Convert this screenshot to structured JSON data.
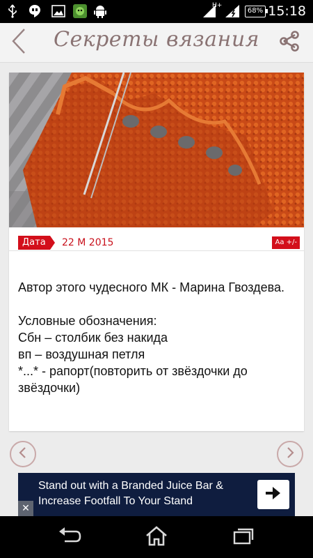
{
  "status_bar": {
    "network_label": "H+",
    "battery": "68%",
    "time": "15:18",
    "icons": [
      "usb-icon",
      "hangouts-icon",
      "gallery-icon",
      "game-icon",
      "android-icon",
      "signal-icon",
      "wifi-icon",
      "battery-icon"
    ]
  },
  "header": {
    "title": "Секреты вязания",
    "back_icon": "chevron-left-icon",
    "share_icon": "share-icon"
  },
  "article": {
    "image": "knitted-orange-lace-photo",
    "date_label": "Дата",
    "date_value": "22 M 2015",
    "font_button": "Aa +/-",
    "author_line": "Автор этого чудесного МК - Марина Гвоздева.",
    "legend_title": "Условные обозначения:",
    "legend_items": [
      "Сбн – столбик без накида",
      "вп – воздушная петля",
      "*...* - рапорт(повторить от звёздочки до звёздочки)"
    ]
  },
  "pager": {
    "prev_icon": "chevron-left-circle-icon",
    "next_icon": "chevron-right-circle-icon"
  },
  "ad": {
    "text": "Stand out with a Branded Juice Bar & Increase Footfall To Your Stand",
    "cta_icon": "arrow-right-icon",
    "close_label": "✕"
  },
  "navbar": {
    "icons": [
      "back-icon",
      "home-icon",
      "recent-apps-icon"
    ]
  },
  "colors": {
    "accent_red": "#d30f1b",
    "title_color": "#8a7373",
    "ad_bg": "#0f1d3f"
  }
}
